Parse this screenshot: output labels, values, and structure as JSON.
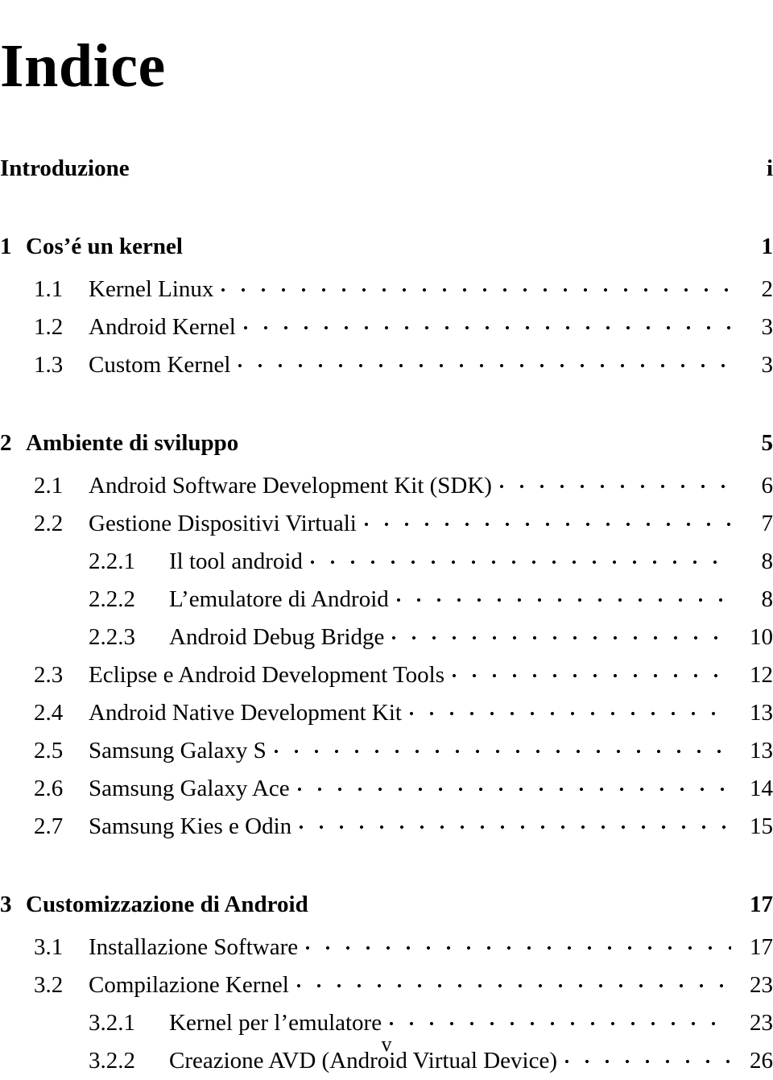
{
  "document": {
    "title": "Indice",
    "footer_page_number": "v"
  },
  "entries": [
    {
      "level": "front",
      "number": "",
      "text": "Introduzione",
      "page": "i",
      "dots": false,
      "gap_before": false
    },
    {
      "level": "chapter",
      "number": "1",
      "text": "Cos’é un kernel",
      "page": "1",
      "dots": false,
      "gap_before": true
    },
    {
      "level": "section",
      "number": "1.1",
      "text": "Kernel Linux",
      "page": "2",
      "dots": true,
      "gap_before": false
    },
    {
      "level": "section",
      "number": "1.2",
      "text": "Android Kernel",
      "page": "3",
      "dots": true,
      "gap_before": false
    },
    {
      "level": "section",
      "number": "1.3",
      "text": "Custom Kernel",
      "page": "3",
      "dots": true,
      "gap_before": false
    },
    {
      "level": "chapter",
      "number": "2",
      "text": "Ambiente di sviluppo",
      "page": "5",
      "dots": false,
      "gap_before": true
    },
    {
      "level": "section",
      "number": "2.1",
      "text": "Android Software Development Kit (SDK)",
      "page": "6",
      "dots": true,
      "gap_before": false
    },
    {
      "level": "section",
      "number": "2.2",
      "text": "Gestione Dispositivi Virtuali",
      "page": "7",
      "dots": true,
      "gap_before": false
    },
    {
      "level": "subsection",
      "number": "2.2.1",
      "text": "Il tool android",
      "page": "8",
      "dots": true,
      "gap_before": false
    },
    {
      "level": "subsection",
      "number": "2.2.2",
      "text": "L’emulatore di Android",
      "page": "8",
      "dots": true,
      "gap_before": false
    },
    {
      "level": "subsection",
      "number": "2.2.3",
      "text": "Android Debug Bridge",
      "page": "10",
      "dots": true,
      "gap_before": false
    },
    {
      "level": "section",
      "number": "2.3",
      "text": "Eclipse e Android Development Tools",
      "page": "12",
      "dots": true,
      "gap_before": false
    },
    {
      "level": "section",
      "number": "2.4",
      "text": "Android Native Development Kit",
      "page": "13",
      "dots": true,
      "gap_before": false
    },
    {
      "level": "section",
      "number": "2.5",
      "text": "Samsung Galaxy S",
      "page": "13",
      "dots": true,
      "gap_before": false
    },
    {
      "level": "section",
      "number": "2.6",
      "text": "Samsung Galaxy Ace",
      "page": "14",
      "dots": true,
      "gap_before": false
    },
    {
      "level": "section",
      "number": "2.7",
      "text": "Samsung Kies e Odin",
      "page": "15",
      "dots": true,
      "gap_before": false
    },
    {
      "level": "chapter",
      "number": "3",
      "text": "Customizzazione di Android",
      "page": "17",
      "dots": false,
      "gap_before": true
    },
    {
      "level": "section",
      "number": "3.1",
      "text": "Installazione Software",
      "page": "17",
      "dots": true,
      "gap_before": false
    },
    {
      "level": "section",
      "number": "3.2",
      "text": "Compilazione Kernel",
      "page": "23",
      "dots": true,
      "gap_before": false
    },
    {
      "level": "subsection",
      "number": "3.2.1",
      "text": "Kernel per l’emulatore",
      "page": "23",
      "dots": true,
      "gap_before": false
    },
    {
      "level": "subsection",
      "number": "3.2.2",
      "text": "Creazione AVD (Android Virtual Device)",
      "page": "26",
      "dots": true,
      "gap_before": false
    }
  ]
}
